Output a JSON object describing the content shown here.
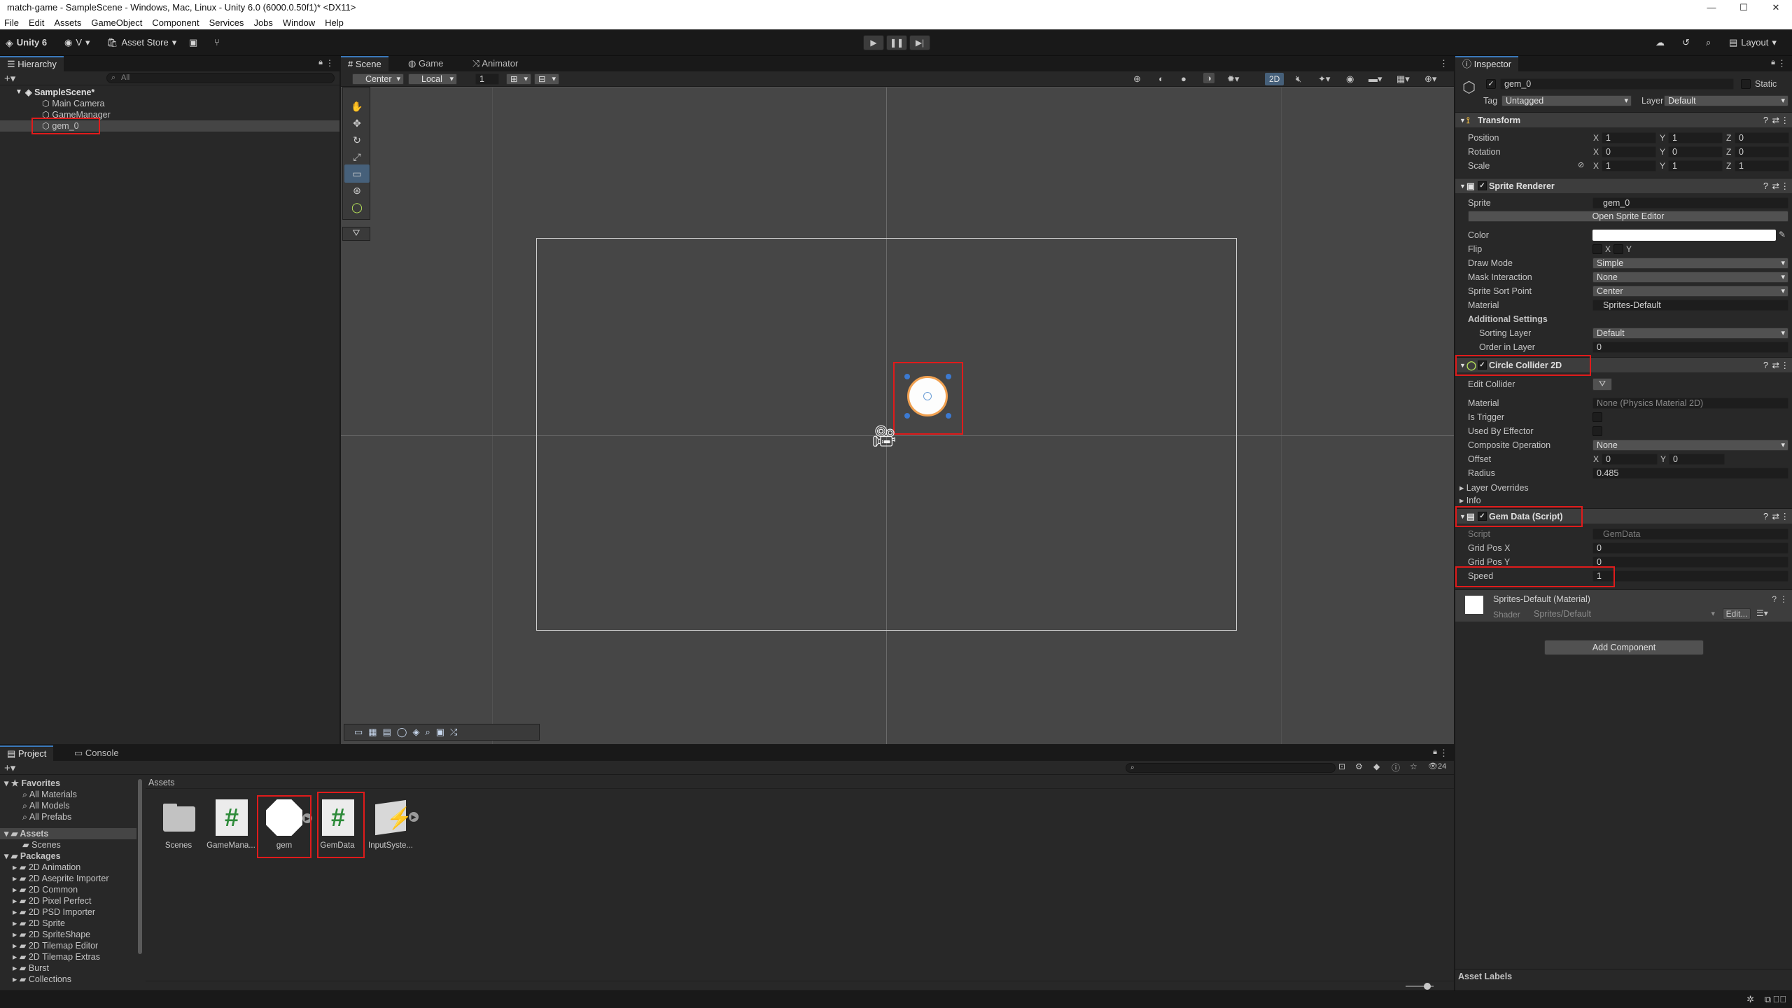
{
  "window": {
    "title": "match-game - SampleScene - Windows, Mac, Linux - Unity 6.0 (6000.0.50f1)* <DX11>",
    "controls": [
      "—",
      "☐",
      "✕"
    ]
  },
  "menu": [
    "File",
    "Edit",
    "Assets",
    "GameObject",
    "Component",
    "Services",
    "Jobs",
    "Window",
    "Help"
  ],
  "toolbar": {
    "unity": "Unity 6",
    "account": "V",
    "asset_store": "Asset Store",
    "layout": "Layout"
  },
  "hierarchy": {
    "tab": "Hierarchy",
    "search_placeholder": "All",
    "scene": "SampleScene*",
    "items": [
      "Main Camera",
      "GameManager",
      "gem_0"
    ]
  },
  "scene_tabs": [
    "Scene",
    "Game",
    "Animator"
  ],
  "scene_toolbar": {
    "pivot": "Center",
    "space": "Local",
    "snap": "1",
    "mode_2d": "2D"
  },
  "inspector": {
    "tab": "Inspector",
    "object_name": "gem_0",
    "static_label": "Static",
    "tag_label": "Tag",
    "tag": "Untagged",
    "layer_label": "Layer",
    "layer": "Default",
    "transform": {
      "title": "Transform",
      "position": {
        "label": "Position",
        "x": "1",
        "y": "1",
        "z": "0"
      },
      "rotation": {
        "label": "Rotation",
        "x": "0",
        "y": "0",
        "z": "0"
      },
      "scale": {
        "label": "Scale",
        "x": "1",
        "y": "1",
        "z": "1"
      }
    },
    "sprite_renderer": {
      "title": "Sprite Renderer",
      "sprite_label": "Sprite",
      "sprite": "gem_0",
      "open_editor": "Open Sprite Editor",
      "color_label": "Color",
      "flip_label": "Flip",
      "flip_x": "X",
      "flip_y": "Y",
      "draw_mode_label": "Draw Mode",
      "draw_mode": "Simple",
      "mask_label": "Mask Interaction",
      "mask": "None",
      "sort_point_label": "Sprite Sort Point",
      "sort_point": "Center",
      "material_label": "Material",
      "material": "Sprites-Default",
      "additional": "Additional Settings",
      "sorting_layer_label": "Sorting Layer",
      "sorting_layer": "Default",
      "order_label": "Order in Layer",
      "order": "0"
    },
    "circle_collider": {
      "title": "Circle Collider 2D",
      "edit_label": "Edit Collider",
      "material_label": "Material",
      "material": "None (Physics Material 2D)",
      "trigger_label": "Is Trigger",
      "effector_label": "Used By Effector",
      "composite_label": "Composite Operation",
      "composite": "None",
      "offset_label": "Offset",
      "offset_x": "0",
      "offset_y": "0",
      "radius_label": "Radius",
      "radius": "0.485",
      "overrides": "Layer Overrides",
      "info": "Info"
    },
    "gem_data": {
      "title": "Gem Data (Script)",
      "script_label": "Script",
      "script": "GemData",
      "gridx_label": "Grid Pos X",
      "gridx": "0",
      "gridy_label": "Grid Pos Y",
      "gridy": "0",
      "speed_label": "Speed",
      "speed": "1"
    },
    "material": {
      "title": "Sprites-Default (Material)",
      "shader_label": "Shader",
      "shader": "Sprites/Default",
      "edit": "Edit..."
    },
    "add_component": "Add Component",
    "asset_labels": "Asset Labels"
  },
  "project": {
    "tabs": [
      "Project",
      "Console"
    ],
    "favorites": "Favorites",
    "fav_items": [
      "All Materials",
      "All Models",
      "All Prefabs"
    ],
    "assets": "Assets",
    "asset_children": [
      "Scenes"
    ],
    "packages": "Packages",
    "package_items": [
      "2D Animation",
      "2D Aseprite Importer",
      "2D Common",
      "2D Pixel Perfect",
      "2D PSD Importer",
      "2D Sprite",
      "2D SpriteShape",
      "2D Tilemap Editor",
      "2D Tilemap Extras",
      "Burst",
      "Collections"
    ],
    "breadcrumb": "Assets",
    "hidden_count": "24",
    "grid": [
      "Scenes",
      "GameMana...",
      "gem",
      "GemData",
      "InputSyste..."
    ]
  },
  "colors": {
    "accent": "#3a79bb",
    "highlight": "#e01b1b",
    "scene_bg": "#464646",
    "panel": "#282828"
  }
}
